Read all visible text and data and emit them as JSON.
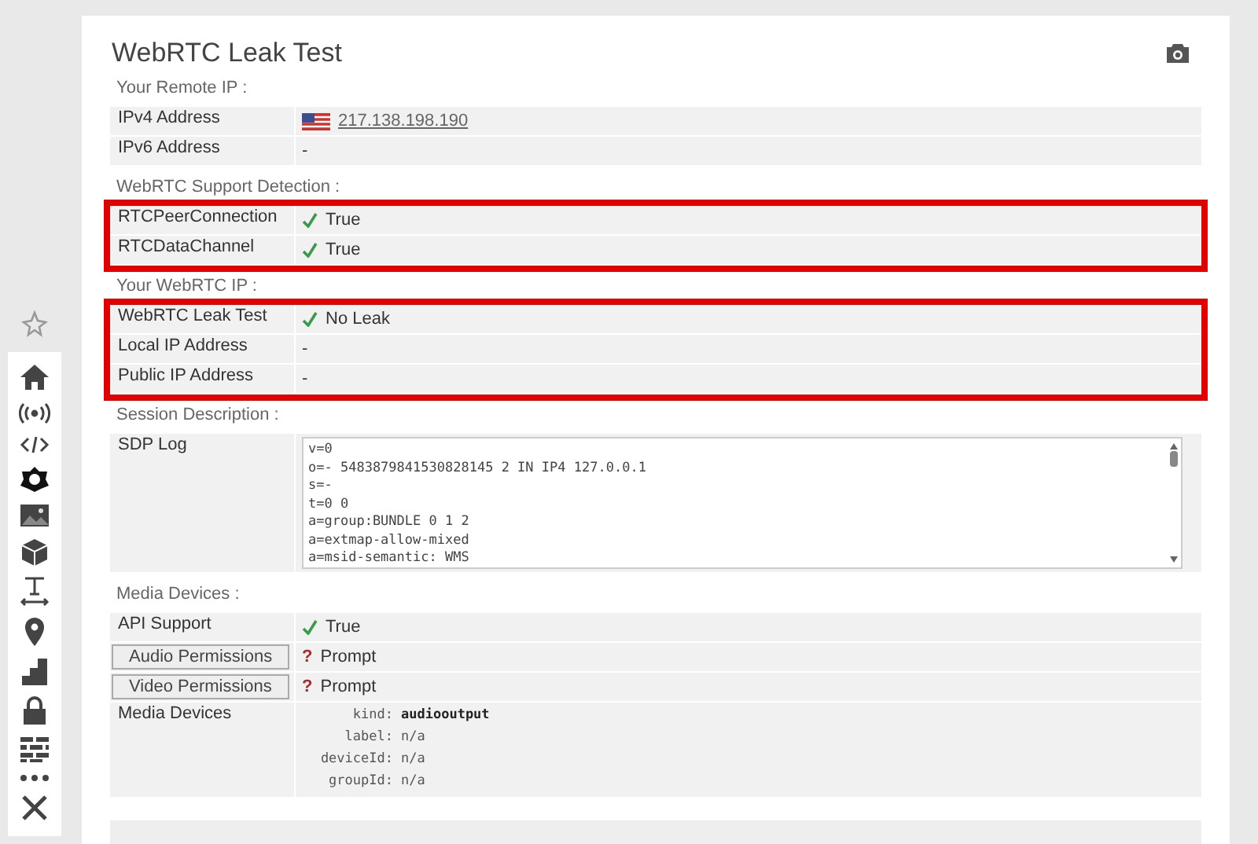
{
  "title": "WebRTC Leak Test",
  "sections": [
    {
      "heading": "Your Remote IP :",
      "highlighted": false,
      "rows": [
        {
          "kind": "ip",
          "label": "IPv4 Address",
          "value": "217.138.198.190"
        },
        {
          "kind": "text",
          "label": "IPv6 Address",
          "value": "-"
        }
      ]
    },
    {
      "heading": "WebRTC Support Detection :",
      "highlighted": true,
      "rows": [
        {
          "kind": "check",
          "label": "RTCPeerConnection",
          "value": "True"
        },
        {
          "kind": "check",
          "label": "RTCDataChannel",
          "value": "True"
        }
      ]
    },
    {
      "heading": "Your WebRTC IP :",
      "highlighted": true,
      "rows": [
        {
          "kind": "check",
          "label": "WebRTC Leak Test",
          "value": "No Leak"
        },
        {
          "kind": "text",
          "label": "Local IP Address",
          "value": "-"
        },
        {
          "kind": "text",
          "label": "Public IP Address",
          "value": "-"
        }
      ]
    },
    {
      "heading": "Session Description :",
      "highlighted": false,
      "rows": [
        {
          "kind": "log",
          "label": "SDP Log",
          "lines": [
            "v=0",
            "o=- 5483879841530828145 2 IN IP4 127.0.0.1",
            "s=-",
            "t=0 0",
            "a=group:BUNDLE 0 1 2",
            "a=extmap-allow-mixed",
            "a=msid-semantic: WMS"
          ]
        }
      ]
    },
    {
      "heading": "Media Devices :",
      "highlighted": false,
      "rows": [
        {
          "kind": "check",
          "label": "API Support",
          "value": "True"
        },
        {
          "kind": "prompt",
          "label": "Audio Permissions",
          "mark": "?",
          "value": "Prompt"
        },
        {
          "kind": "prompt",
          "label": "Video Permissions",
          "mark": "?",
          "value": "Prompt"
        },
        {
          "kind": "devices",
          "label": "Media Devices",
          "entries": [
            {
              "key": "kind:",
              "value": "audiooutput"
            },
            {
              "key": "label:",
              "value": "n/a"
            },
            {
              "key": "deviceId:",
              "value": "n/a"
            },
            {
              "key": "groupId:",
              "value": "n/a"
            }
          ]
        }
      ]
    }
  ]
}
